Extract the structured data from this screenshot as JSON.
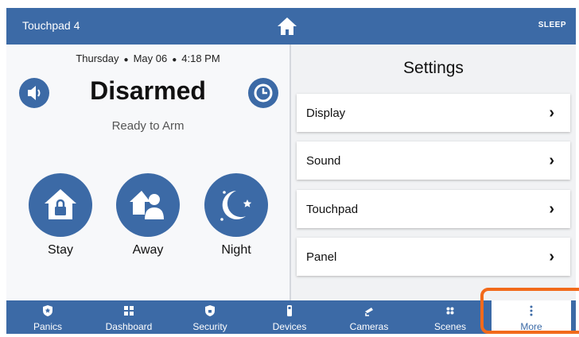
{
  "topbar": {
    "device_name": "Touchpad 4",
    "sleep_label": "SLEEP",
    "home_icon": "home-icon",
    "sleep_icon": "moon-icon"
  },
  "status": {
    "day": "Thursday",
    "date": "May 06",
    "time": "4:18 PM",
    "state": "Disarmed",
    "substate": "Ready to Arm"
  },
  "arm_buttons": [
    {
      "label": "Stay",
      "icon": "house-lock-icon"
    },
    {
      "label": "Away",
      "icon": "house-person-icon"
    },
    {
      "label": "Night",
      "icon": "moon-stars-icon"
    }
  ],
  "settings": {
    "title": "Settings",
    "items": [
      {
        "label": "Display"
      },
      {
        "label": "Sound"
      },
      {
        "label": "Touchpad"
      },
      {
        "label": "Panel"
      }
    ]
  },
  "nav": [
    {
      "label": "Panics",
      "icon": "shield-star-icon"
    },
    {
      "label": "Dashboard",
      "icon": "grid-icon"
    },
    {
      "label": "Security",
      "icon": "shield-lock-icon"
    },
    {
      "label": "Devices",
      "icon": "device-icon"
    },
    {
      "label": "Cameras",
      "icon": "camera-icon"
    },
    {
      "label": "Scenes",
      "icon": "scenes-icon"
    },
    {
      "label": "More",
      "icon": "more-vertical-icon",
      "active": true
    }
  ],
  "colors": {
    "primary": "#3c6aa6",
    "highlight": "#f26a1b",
    "background": "#f2f3f5"
  }
}
